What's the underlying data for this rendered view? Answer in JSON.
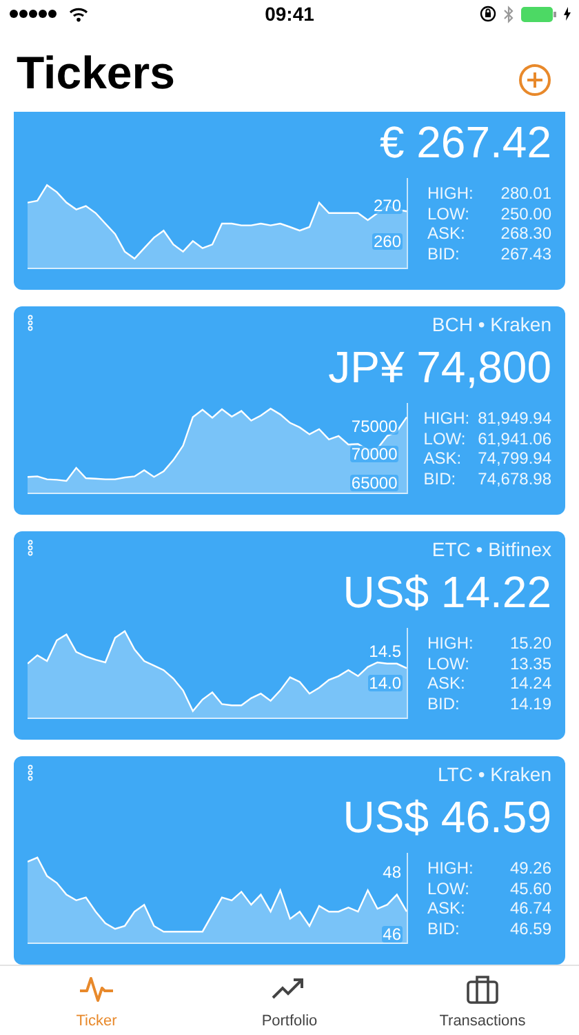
{
  "status_bar": {
    "time": "09:41"
  },
  "header": {
    "title": "Tickers"
  },
  "tickers": [
    {
      "price": "€ 267.42",
      "chart_data": {
        "type": "area",
        "ylim": [
          252,
          278
        ],
        "yticks": [
          270,
          260
        ],
        "values": [
          271,
          271.5,
          276,
          274,
          271,
          269,
          270,
          268,
          265,
          262,
          257,
          255,
          258,
          261,
          263,
          259,
          257,
          260,
          258,
          259,
          265,
          265,
          264.5,
          264.5,
          265,
          264.5,
          265,
          264,
          263,
          264,
          271,
          268,
          268,
          268,
          268,
          266,
          268,
          270,
          269,
          268.5
        ]
      },
      "stats": [
        {
          "label": "HIGH:",
          "value": "280.01"
        },
        {
          "label": "LOW:",
          "value": "250.00"
        },
        {
          "label": "ASK:",
          "value": "268.30"
        },
        {
          "label": "BID:",
          "value": "267.43"
        }
      ]
    },
    {
      "pair": "BCH • Kraken",
      "price": "JP¥ 74,800",
      "chart_data": {
        "type": "area",
        "ylim": [
          63000,
          79000
        ],
        "yticks": [
          75000,
          70000,
          65000
        ],
        "values": [
          66000,
          66100,
          65600,
          65500,
          65300,
          67600,
          65800,
          65700,
          65600,
          65600,
          65900,
          66100,
          67200,
          66000,
          67000,
          69000,
          71500,
          76500,
          77800,
          76400,
          77900,
          76600,
          77600,
          75900,
          76800,
          78000,
          77000,
          75500,
          74700,
          73500,
          74400,
          72600,
          73200,
          71700,
          71800,
          70800,
          71000,
          73200,
          74000,
          76500
        ]
      },
      "stats": [
        {
          "label": "HIGH:",
          "value": "81,949.94"
        },
        {
          "label": "LOW:",
          "value": "61,941.06"
        },
        {
          "label": "ASK:",
          "value": "74,799.94"
        },
        {
          "label": "BID:",
          "value": "74,678.98"
        }
      ]
    },
    {
      "pair": "ETC • Bitfinex",
      "price": "US$ 14.22",
      "chart_data": {
        "type": "area",
        "ylim": [
          13.45,
          14.85
        ],
        "yticks": [
          14.5,
          {
            "value": 14,
            "label": "14.0"
          }
        ],
        "values": [
          14.3,
          14.43,
          14.34,
          14.66,
          14.75,
          14.48,
          14.41,
          14.36,
          14.32,
          14.7,
          14.8,
          14.52,
          14.34,
          14.27,
          14.2,
          14.07,
          13.89,
          13.57,
          13.75,
          13.86,
          13.68,
          13.66,
          13.66,
          13.77,
          13.84,
          13.73,
          13.89,
          14.09,
          14.02,
          13.84,
          13.93,
          14.05,
          14.11,
          14.2,
          14.11,
          14.25,
          14.32,
          14.3,
          14.3,
          14.23
        ]
      },
      "stats": [
        {
          "label": "HIGH:",
          "value": "15.20"
        },
        {
          "label": "LOW:",
          "value": "13.35"
        },
        {
          "label": "ASK:",
          "value": "14.24"
        },
        {
          "label": "BID:",
          "value": "14.19"
        }
      ]
    },
    {
      "pair": "LTC • Kraken",
      "price": "US$ 46.59",
      "chart_data": {
        "type": "area",
        "ylim": [
          45.7,
          48.6
        ],
        "yticks": [
          48,
          46
        ],
        "values": [
          48.32,
          48.45,
          47.86,
          47.64,
          47.27,
          47.09,
          47.18,
          46.73,
          46.36,
          46.18,
          46.27,
          46.73,
          46.95,
          46.27,
          46.09,
          46.09,
          46.09,
          46.09,
          46.09,
          46.64,
          47.18,
          47.09,
          47.36,
          46.95,
          47.27,
          46.73,
          47.41,
          46.5,
          46.73,
          46.27,
          46.91,
          46.73,
          46.73,
          46.86,
          46.73,
          47.41,
          46.82,
          46.95,
          47.27,
          46.73
        ]
      },
      "stats": [
        {
          "label": "HIGH:",
          "value": "49.26"
        },
        {
          "label": "LOW:",
          "value": "45.60"
        },
        {
          "label": "ASK:",
          "value": "46.74"
        },
        {
          "label": "BID:",
          "value": "46.59"
        }
      ]
    }
  ],
  "tab_bar": [
    {
      "kind": "ticker",
      "label": "Ticker",
      "selected": true
    },
    {
      "kind": "portfolio",
      "label": "Portfolio",
      "selected": false
    },
    {
      "kind": "transactions",
      "label": "Transactions",
      "selected": false
    }
  ]
}
